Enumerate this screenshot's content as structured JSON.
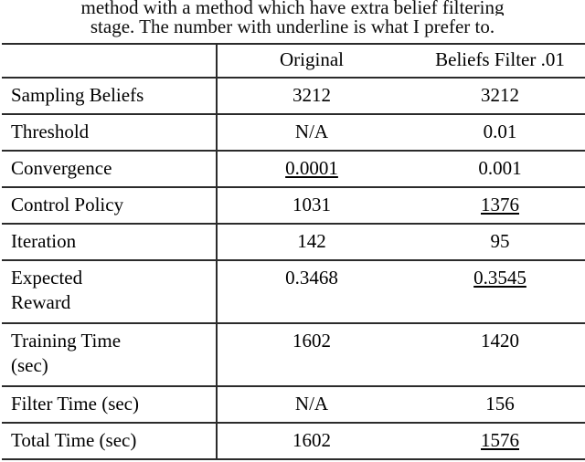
{
  "caption": {
    "line1": "method with a method which have extra belief filtering",
    "line2": "stage. The number with underline is what I prefer to."
  },
  "table": {
    "columns": [
      {
        "label": ""
      },
      {
        "label": "Original"
      },
      {
        "label": "Beliefs Filter .01"
      }
    ],
    "rows": [
      {
        "label": "Sampling Beliefs",
        "original": "3212",
        "original_underlined": false,
        "filter": "3212",
        "filter_underlined": false
      },
      {
        "label": "Threshold",
        "original": "N/A",
        "original_underlined": false,
        "filter": "0.01",
        "filter_underlined": false
      },
      {
        "label": "Convergence",
        "original": "0.0001",
        "original_underlined": true,
        "filter": "0.001",
        "filter_underlined": false
      },
      {
        "label": "Control Policy",
        "original": "1031",
        "original_underlined": false,
        "filter": "1376",
        "filter_underlined": true
      },
      {
        "label": "Iteration",
        "original": "142",
        "original_underlined": false,
        "filter": "95",
        "filter_underlined": false
      },
      {
        "label": "Expected\nReward",
        "original": "0.3468",
        "original_underlined": false,
        "filter": "0.3545",
        "filter_underlined": true
      },
      {
        "label": "Training Time\n(sec)",
        "original": "1602",
        "original_underlined": false,
        "filter": "1420",
        "filter_underlined": false
      },
      {
        "label": "Filter Time (sec)",
        "original": "N/A",
        "original_underlined": false,
        "filter": "156",
        "filter_underlined": false
      },
      {
        "label": "Total Time (sec)",
        "original": "1602",
        "original_underlined": false,
        "filter": "1576",
        "filter_underlined": true
      }
    ]
  },
  "colors": {
    "rule": "#2b2b2b",
    "text": "#000000",
    "background": "#ffffff"
  }
}
